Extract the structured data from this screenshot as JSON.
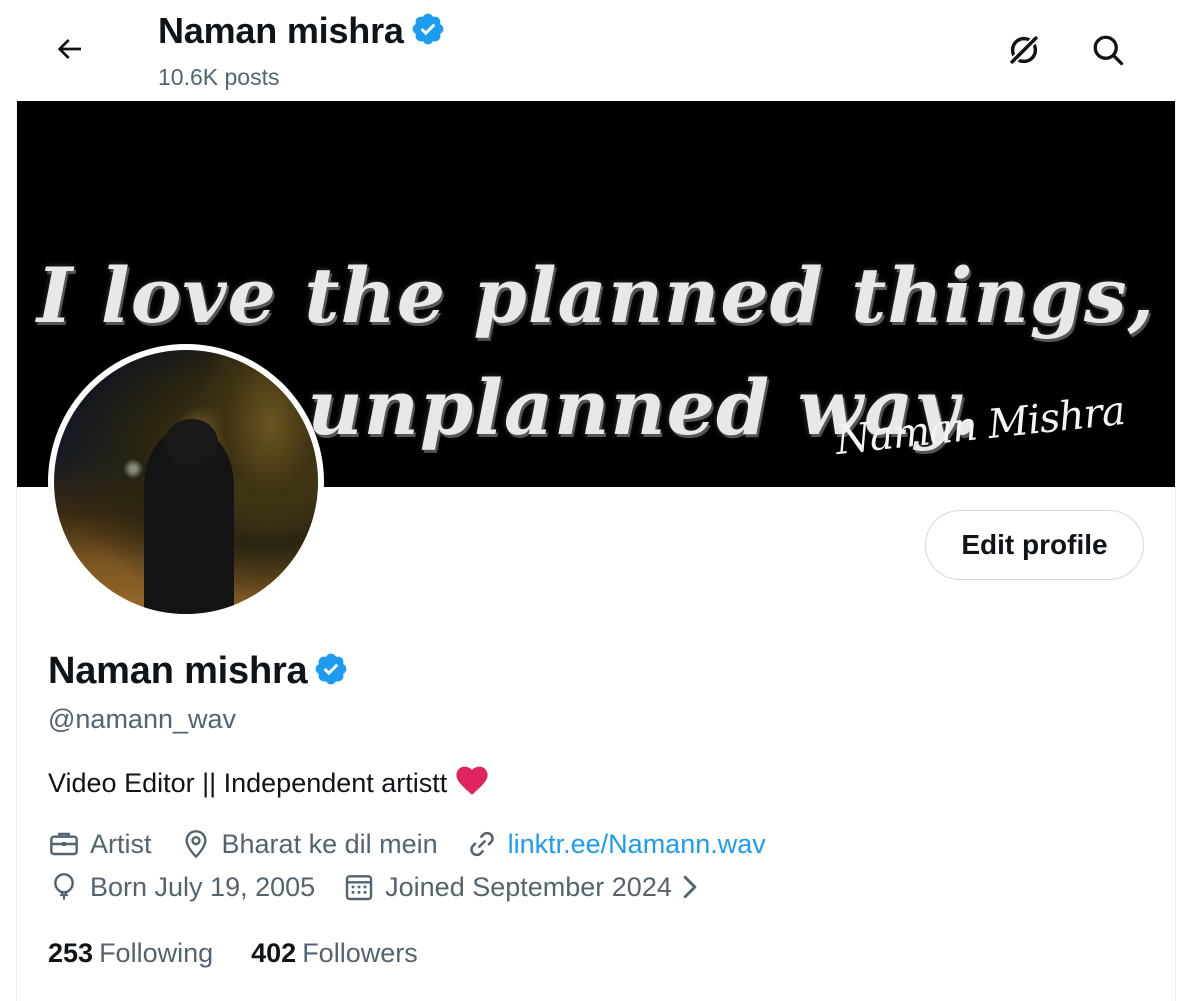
{
  "header": {
    "name": "Naman mishra",
    "posts": "10.6K posts"
  },
  "banner": {
    "line1": "I love the planned things,",
    "line2": "in unplanned way.",
    "signature": "Naman Mishra"
  },
  "profile": {
    "edit_button": "Edit profile",
    "name": "Naman mishra",
    "handle": "@namann_wav",
    "bio": "Video Editor || Independent artistt",
    "bio_emoji": "red-heart-icon",
    "category": "Artist",
    "location": "Bharat ke dil mein",
    "link": "linktr.ee/Namann.wav",
    "born": "Born July 19, 2005",
    "joined": "Joined September 2024"
  },
  "stats": {
    "following_count": "253",
    "following_label": "Following",
    "followers_count": "402",
    "followers_label": "Followers"
  },
  "colors": {
    "text_primary": "#0f1419",
    "text_secondary": "#536471",
    "link": "#1d9bf0",
    "verified": "#1d9bf0",
    "heart": "#e0245e"
  },
  "icons": {
    "back": "arrow-left-icon",
    "grok": "grok-icon",
    "search": "search-icon",
    "verified": "verified-badge-icon",
    "category": "briefcase-icon",
    "location": "location-pin-icon",
    "link": "link-icon",
    "born": "balloon-icon",
    "joined": "calendar-icon",
    "chevron": "chevron-right-icon"
  }
}
